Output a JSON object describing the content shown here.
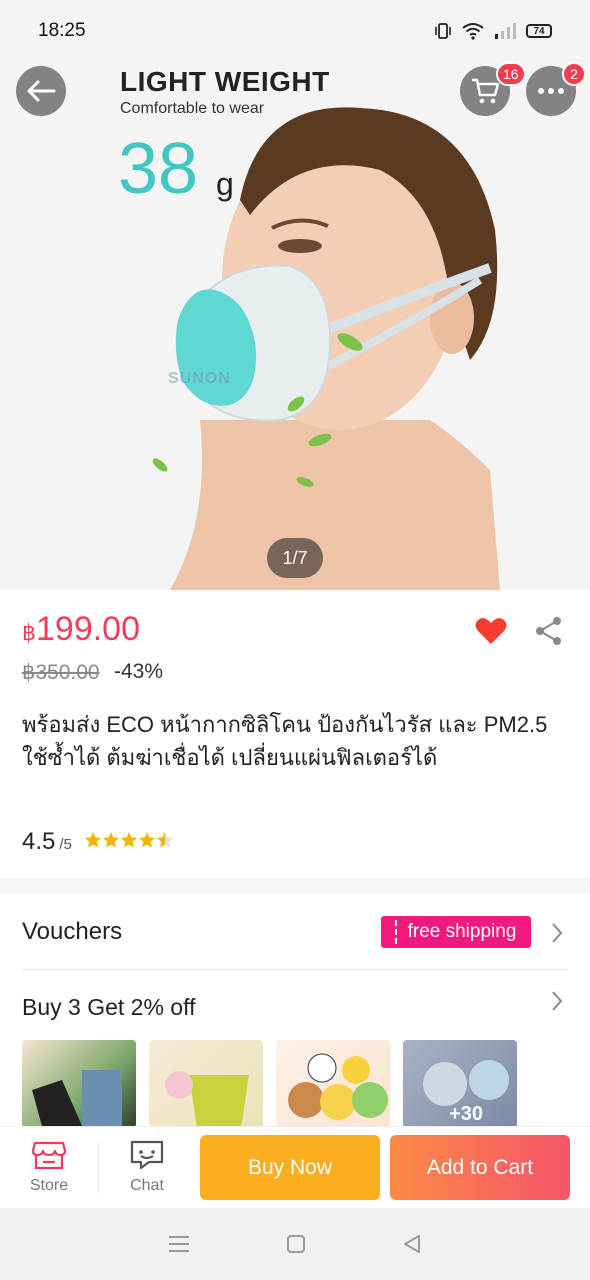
{
  "status_bar": {
    "time": "18:25",
    "battery": "74"
  },
  "hero": {
    "title": "LIGHT WEIGHT",
    "subtitle": "Comfortable to wear",
    "weight_value": "38",
    "weight_unit": "g",
    "watermark": "SUNON",
    "pager": "1/7"
  },
  "top_actions": {
    "cart_badge": "16",
    "more_badge": "2"
  },
  "product": {
    "currency": "฿",
    "price": "199.00",
    "original_price": "฿350.00",
    "discount": "-43%",
    "title": "พร้อมส่ง ECO หน้ากากซิลิโคน ป้องกันไวรัส และ PM2.5 ใช้ซ้ำได้ ต้มฆ่าเชื่อได้ เปลี่ยนแผ่นฟิลเตอร์ได้",
    "rating": "4.5",
    "rating_out_of": "/5",
    "rating_fraction": 0.9,
    "favorited": true
  },
  "vouchers": {
    "label": "Vouchers",
    "tag": "free shipping"
  },
  "promo": {
    "label": "Buy 3 Get 2% off",
    "more_count": "+30"
  },
  "bottom_bar": {
    "store_label": "Store",
    "chat_label": "Chat",
    "buy_now_label": "Buy Now",
    "add_to_cart_label": "Add to Cart"
  },
  "colors": {
    "price": "#f23d5a",
    "buy_now": "#fbad20",
    "add_to_cart_start": "#fb8a45",
    "add_to_cart_end": "#f6546a",
    "voucher_tag": "#f0197d",
    "favorite": "#f23d30"
  }
}
